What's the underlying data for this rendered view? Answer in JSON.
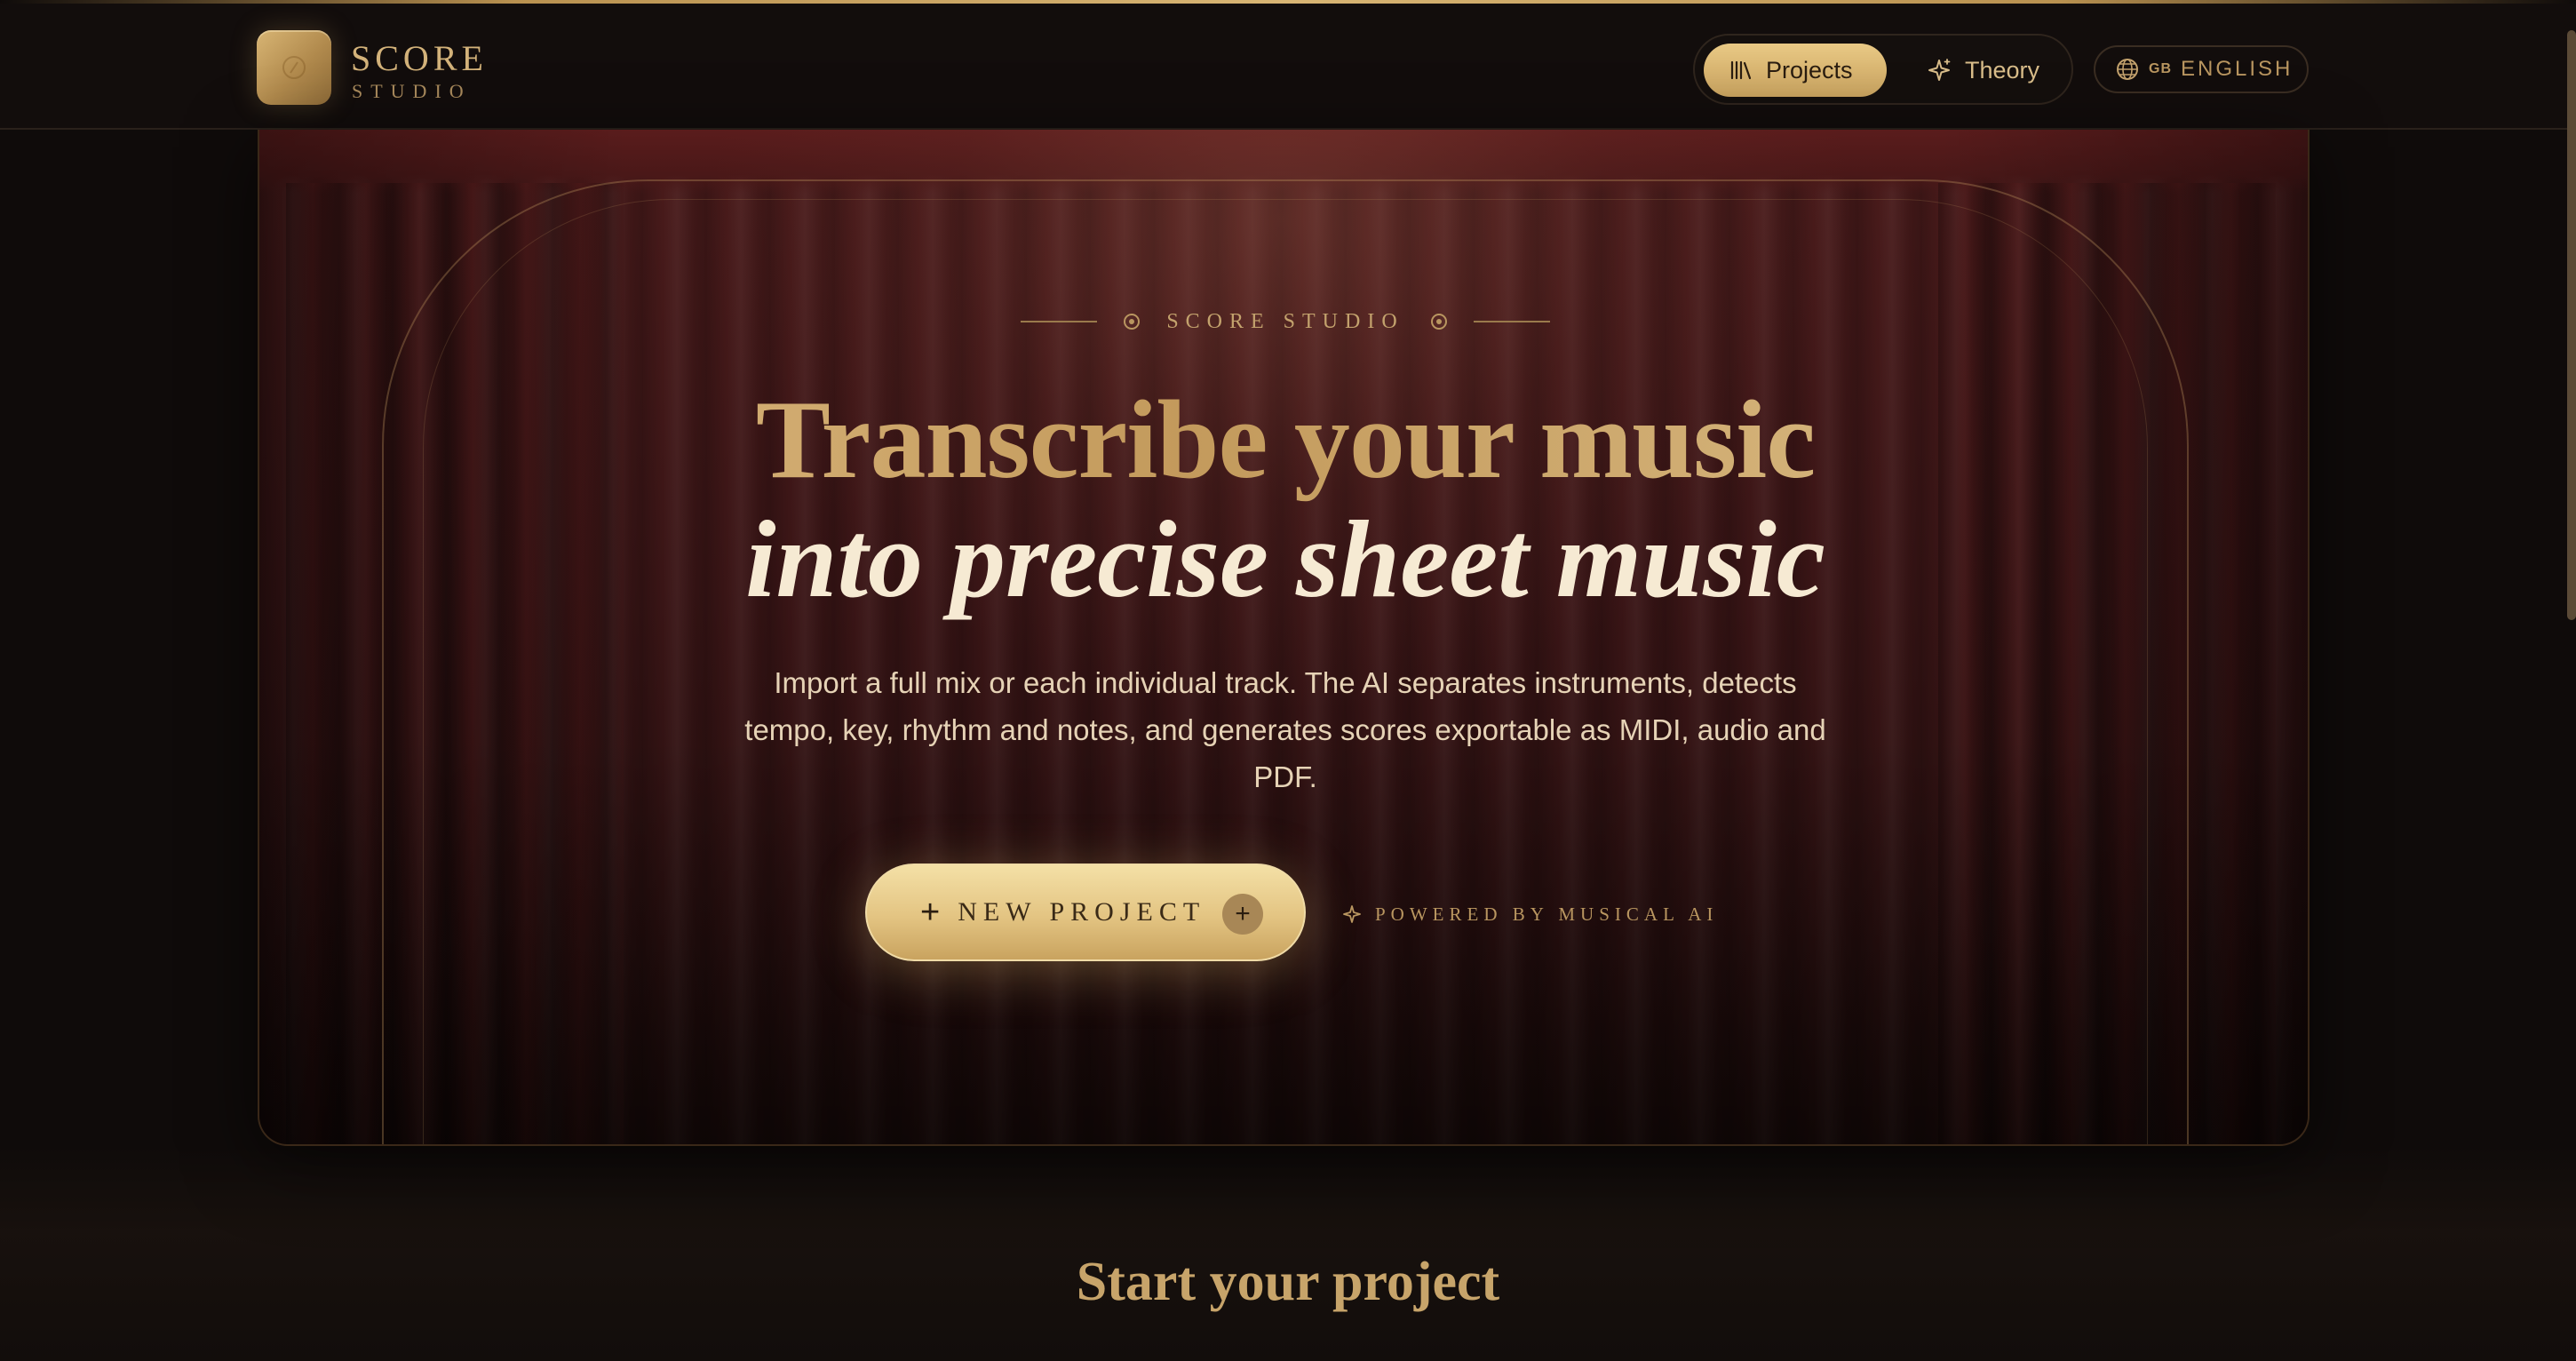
{
  "brand": {
    "title": "SCORE",
    "subtitle": "STUDIO"
  },
  "nav": {
    "projects_label": "Projects",
    "theory_label": "Theory",
    "language_flag": "GB",
    "language_label": "ENGLISH"
  },
  "hero": {
    "eyebrow": "SCORE STUDIO",
    "title_line1": "Transcribe your music",
    "title_line2": "into precise sheet music",
    "description": "Import a full mix or each individual track. The AI separates instruments, detects tempo, key, rhythm and notes, and generates scores exportable as MIDI, audio and PDF.",
    "cta_label": "NEW PROJECT",
    "powered_by": "POWERED BY MUSICAL AI"
  },
  "section": {
    "title": "Start your project"
  },
  "colors": {
    "background": "#0f0b0a",
    "gold": "#d3b27a",
    "curtain": "#3a1516",
    "cta_gold": "#e3c482"
  },
  "icons": {
    "logo": "score-studio-logo-icon",
    "projects": "library-books-icon",
    "theory": "sparkle-icon",
    "language": "globe-icon",
    "cta_plus": "plus-icon",
    "cta_circle": "plus-circle-icon",
    "powered": "sparkle-icon"
  }
}
